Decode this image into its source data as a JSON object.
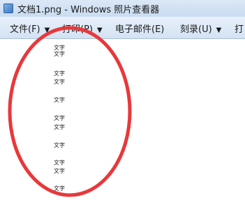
{
  "window": {
    "title": "文档1.png - Windows 照片查看器"
  },
  "menu": {
    "items": [
      {
        "label": "文件(F)"
      },
      {
        "label": "打印(P)"
      },
      {
        "label": "电子邮件(E)"
      },
      {
        "label": "刻录(U)"
      },
      {
        "label": "打"
      }
    ]
  },
  "image": {
    "lines": [
      "文字",
      "文字",
      "文字",
      "文字",
      "文字",
      "文字",
      "文字",
      "文字",
      "文字",
      "文字",
      "文字",
      "文字"
    ]
  },
  "annotation": {
    "color": "#e8383b"
  }
}
